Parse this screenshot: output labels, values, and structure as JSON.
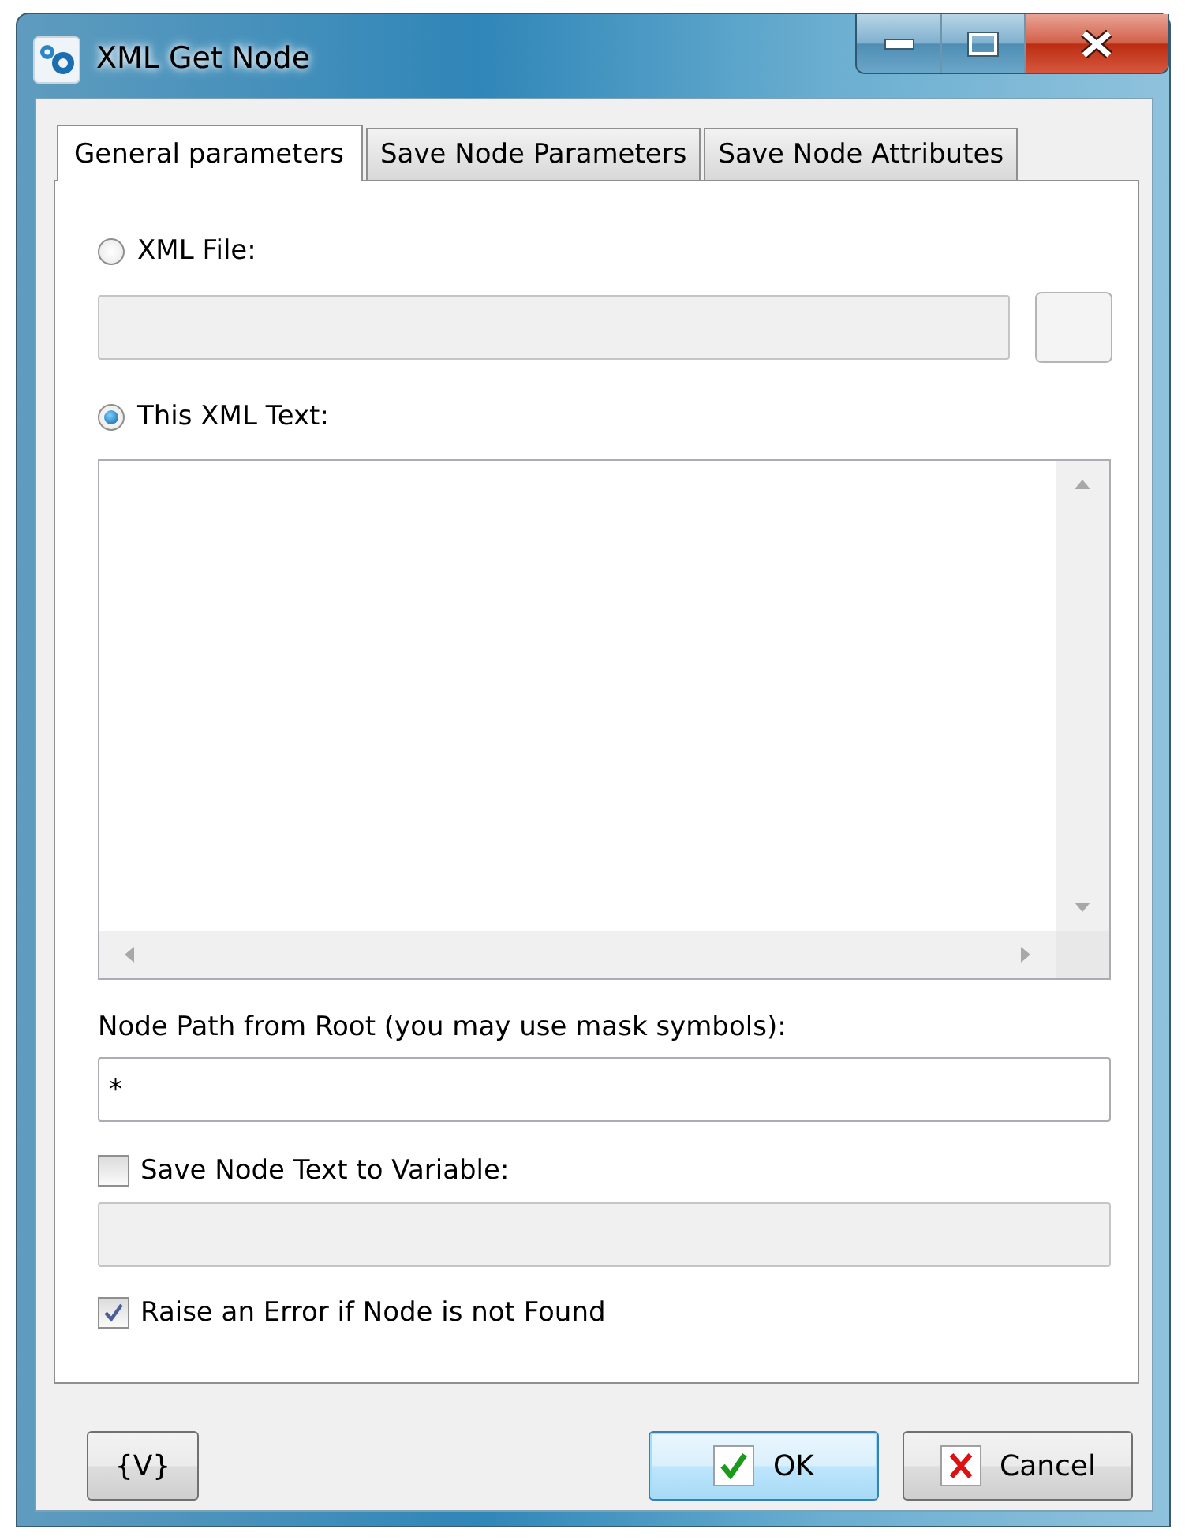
{
  "window": {
    "title": "XML Get Node"
  },
  "tabs": [
    {
      "label": "General parameters",
      "selected": true
    },
    {
      "label": "Save Node Parameters",
      "selected": false
    },
    {
      "label": "Save Node Attributes",
      "selected": false
    }
  ],
  "source_options": [
    {
      "label": "XML File:",
      "selected": false
    },
    {
      "label": "This XML Text:",
      "selected": true
    }
  ],
  "file_field": {
    "disabled": true
  },
  "node_path": {
    "label": "Node Path from Root (you may use mask symbols):",
    "value": "*"
  },
  "save_node_text": {
    "label": "Save Node Text to Variable:",
    "checked": false
  },
  "variable_field": {
    "disabled": true
  },
  "raise_error": {
    "label": "Raise an Error if Node is not Found",
    "checked": true
  },
  "buttons": [
    {
      "label": "{V}",
      "kind": "plain"
    },
    {
      "label": "OK",
      "kind": "ok"
    },
    {
      "label": "Cancel",
      "kind": "cancel"
    }
  ]
}
